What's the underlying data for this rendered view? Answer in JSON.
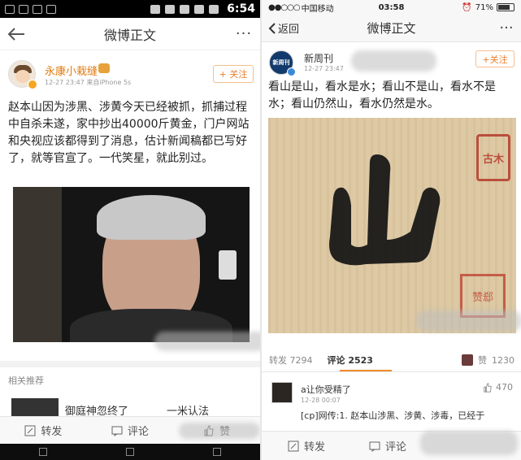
{
  "left": {
    "status": {
      "time": "6:54"
    },
    "nav": {
      "title": "微博正文",
      "more": "···"
    },
    "author": {
      "name": "永康小栽缝",
      "meta": "12-27 23:47  来自iPhone 5s",
      "follow": "+ 关注"
    },
    "post_text": "赵本山因为涉黑、涉黄今天已经被抓，抓捕过程中自杀未遂，家中抄出40000斤黄金，门户网站和央视应该都得到了消息，估计新闻稿都已写好了，就等官宣了。一代笑星，就此别过。",
    "related": {
      "title": "相关推荐",
      "item1": "御庭神",
      "item1b": "忽终了",
      "item2": "一米",
      "item2b": "认法"
    },
    "actions": {
      "repost": "转发",
      "comment": "评论",
      "like": "赞"
    },
    "colors": {
      "name": "#e07a10",
      "follow": "#e8802d"
    }
  },
  "right": {
    "status": {
      "carrier": "中国移动",
      "time": "03:58",
      "battery": "71%"
    },
    "nav": {
      "back": "返回",
      "title": "微博正文",
      "more": "···"
    },
    "author": {
      "name": "新周刊",
      "avatar_text": "新周刊",
      "meta": "12-27 23:47",
      "follow": "+关注"
    },
    "post_text": "看山是山，看水是水；看山不是山，看水不是水；看山仍然山，看水仍然是水。",
    "image": {
      "character": "山",
      "seal1": "古木",
      "seal2": "赞郄"
    },
    "stats": {
      "repost_label": "转发",
      "repost_count": "7294",
      "comment_label": "评论",
      "comment_count": "2523",
      "like_label": "赞",
      "like_count": "1230"
    },
    "comment": {
      "author": "a让你受精了",
      "time": "12-28 00:07",
      "likes": "470",
      "text": "[cp]网传:1. 赵本山涉黑、涉黄、涉毒，已经于"
    },
    "actions": {
      "repost": "转发",
      "comment": "评论"
    },
    "colors": {
      "accent": "#f08a2c",
      "verified": "#3b8ad6"
    }
  }
}
